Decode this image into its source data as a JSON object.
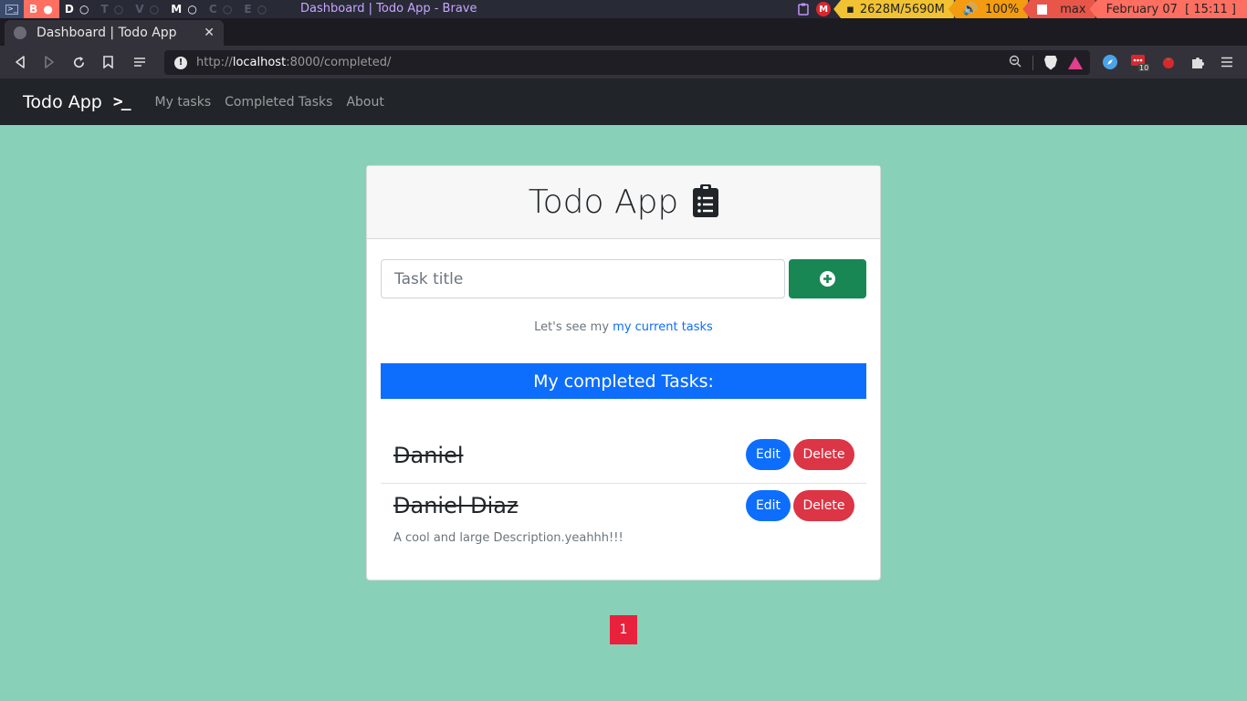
{
  "os_bar": {
    "workspaces": [
      "B",
      "D",
      "T",
      "V",
      "M",
      "C",
      "E"
    ],
    "window_title": "Dashboard | Todo App - Brave",
    "memory": "2628M/5690M",
    "volume": "100%",
    "user": "max",
    "date": "February 07",
    "time": "[ 15:11 ]",
    "mega_label": "M"
  },
  "browser": {
    "tab_title": "Dashboard | Todo App",
    "url_scheme": "http://",
    "url_host": "localhost",
    "url_rest": ":8000/completed/",
    "ext_badge": "10"
  },
  "navbar": {
    "brand": "Todo App",
    "links": [
      "My tasks",
      "Completed Tasks",
      "About"
    ]
  },
  "card": {
    "title": "Todo App",
    "input_placeholder": "Task title",
    "hint_prefix": "Let's see my",
    "hint_link": "my current tasks",
    "section_title": "My completed Tasks:",
    "edit_label": "Edit",
    "delete_label": "Delete",
    "tasks": [
      {
        "title": "Daniel",
        "description": ""
      },
      {
        "title": "Daniel Diaz",
        "description": "A cool and large Description.yeahhh!!!"
      }
    ]
  },
  "pagination": {
    "current": "1"
  },
  "colors": {
    "page_bg": "#88d1b8",
    "navbar_bg": "#212529",
    "add_button": "#198754",
    "primary": "#0d6efd",
    "danger": "#dc3545",
    "page_active": "#e8223c"
  }
}
